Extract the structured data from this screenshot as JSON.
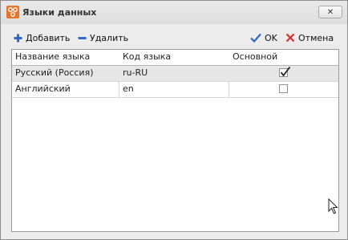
{
  "window": {
    "title": "Языки данных"
  },
  "toolbar": {
    "add_label": "Добавить",
    "delete_label": "Удалить",
    "ok_label": "OK",
    "cancel_label": "Отмена"
  },
  "grid": {
    "columns": [
      "Название языка",
      "Код языка",
      "Основной"
    ],
    "rows": [
      {
        "name": "Русский (Россия)",
        "code": "ru-RU",
        "primary": true,
        "selected": true
      },
      {
        "name": "Английский",
        "code": "en",
        "primary": false,
        "selected": false
      }
    ]
  },
  "colors": {
    "add_icon": "#2f68c8",
    "delete_icon": "#2f68c8",
    "ok_icon": "#2f68c8",
    "cancel_icon": "#d9302a",
    "app_icon": "#e8742b"
  },
  "icons": [
    "app-icon",
    "close-icon",
    "plus-icon",
    "minus-icon",
    "checkmark-icon",
    "x-icon",
    "mouse-cursor-icon"
  ]
}
